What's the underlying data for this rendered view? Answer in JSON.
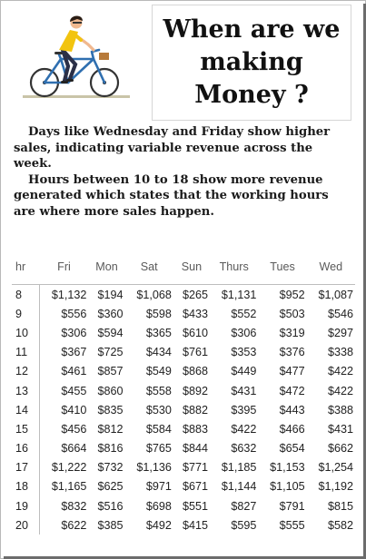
{
  "title": "When are we making Money ?",
  "notes": [
    "Days like Wednesday and Friday show higher sales, indicating variable revenue across the week.",
    "Hours between 10 to 18 show more revenue generated which states that the working hours are where more sales happen."
  ],
  "table": {
    "columns": [
      "hr",
      "Fri",
      "Mon",
      "Sat",
      "Sun",
      "Thurs",
      "Tues",
      "Wed"
    ],
    "rows": [
      [
        "8",
        "$1,132",
        "$194",
        "$1,068",
        "$265",
        "$1,131",
        "$952",
        "$1,087"
      ],
      [
        "9",
        "$556",
        "$360",
        "$598",
        "$433",
        "$552",
        "$503",
        "$546"
      ],
      [
        "10",
        "$306",
        "$594",
        "$365",
        "$610",
        "$306",
        "$319",
        "$297"
      ],
      [
        "11",
        "$367",
        "$725",
        "$434",
        "$761",
        "$353",
        "$376",
        "$338"
      ],
      [
        "12",
        "$461",
        "$857",
        "$549",
        "$868",
        "$449",
        "$477",
        "$422"
      ],
      [
        "13",
        "$455",
        "$860",
        "$558",
        "$892",
        "$431",
        "$472",
        "$422"
      ],
      [
        "14",
        "$410",
        "$835",
        "$530",
        "$882",
        "$395",
        "$443",
        "$388"
      ],
      [
        "15",
        "$456",
        "$812",
        "$584",
        "$883",
        "$422",
        "$466",
        "$431"
      ],
      [
        "16",
        "$664",
        "$816",
        "$765",
        "$844",
        "$632",
        "$654",
        "$662"
      ],
      [
        "17",
        "$1,222",
        "$732",
        "$1,136",
        "$771",
        "$1,185",
        "$1,153",
        "$1,254"
      ],
      [
        "18",
        "$1,165",
        "$625",
        "$971",
        "$671",
        "$1,144",
        "$1,105",
        "$1,192"
      ],
      [
        "19",
        "$832",
        "$516",
        "$698",
        "$551",
        "$827",
        "$791",
        "$815"
      ],
      [
        "20",
        "$622",
        "$385",
        "$492",
        "$415",
        "$595",
        "$555",
        "$582"
      ]
    ]
  },
  "colors": {
    "shirt": "#f2c40f",
    "bike": "#2f6fb0",
    "road": "#c9c4a8"
  },
  "icons": [
    "cyclist-illustration"
  ]
}
